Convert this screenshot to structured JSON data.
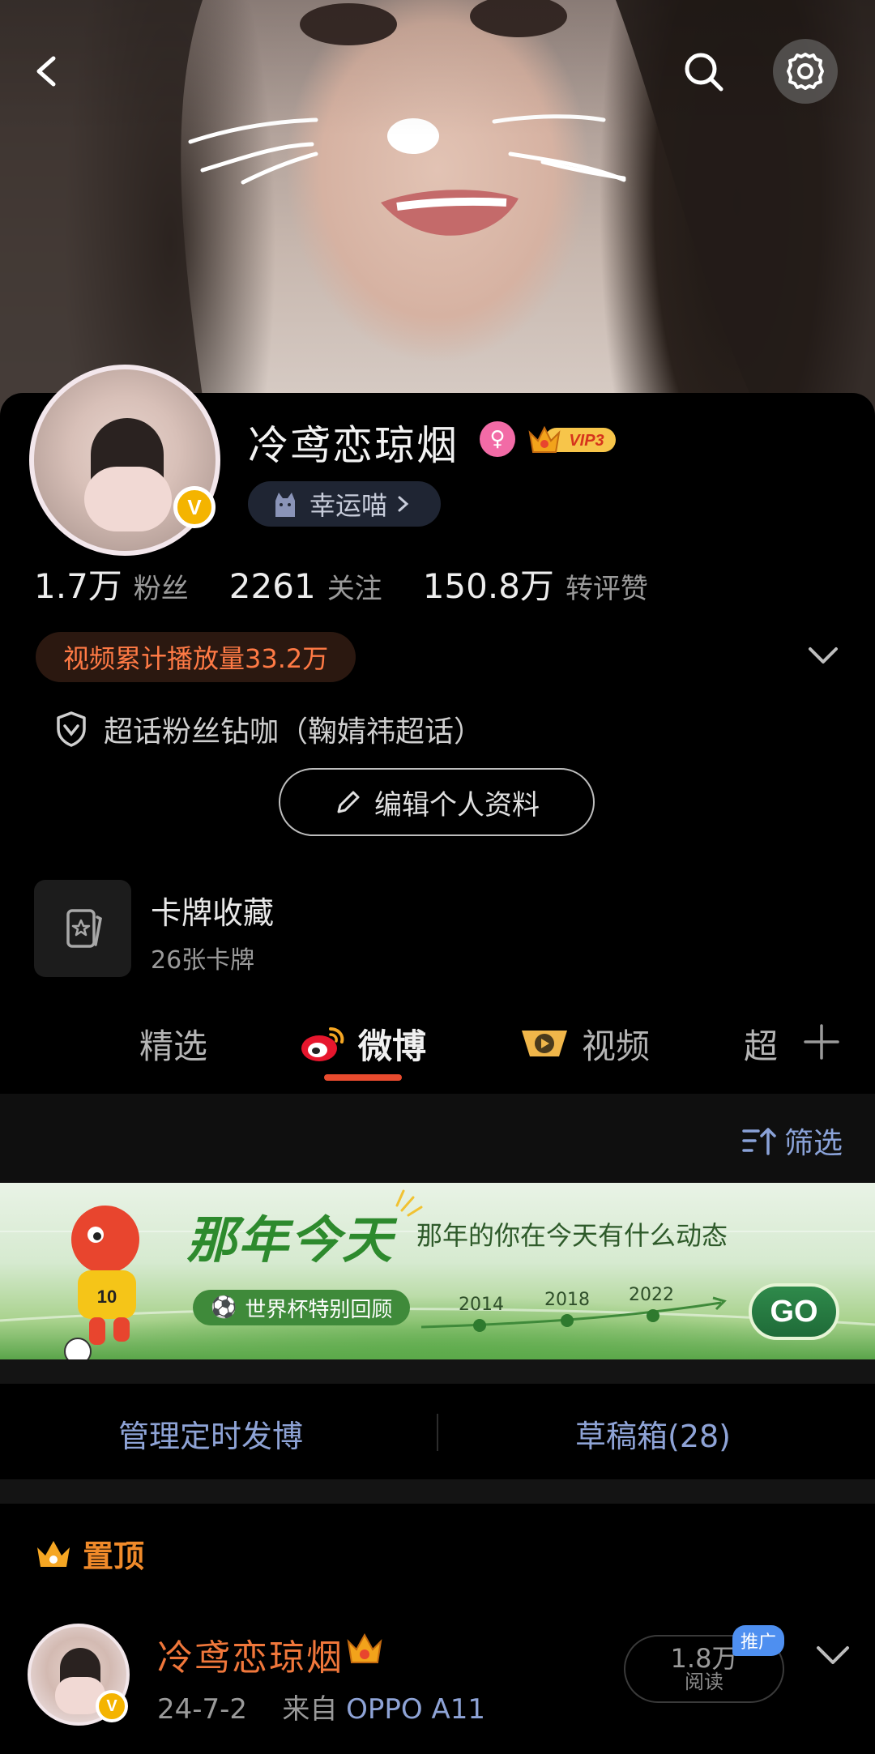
{
  "profile": {
    "name": "冷鸢恋琼烟",
    "vip_label": "VIP3",
    "verified_label": "V",
    "lucky_label": "幸运喵",
    "stats": [
      {
        "value": "1.7万",
        "label": "粉丝"
      },
      {
        "value": "2261",
        "label": "关注"
      },
      {
        "value": "150.8万",
        "label": "转评赞"
      }
    ],
    "play_count": "视频累计播放量33.2万",
    "super_topic": "超话粉丝钻咖（鞠婧祎超话）",
    "edit_button": "编辑个人资料",
    "cards": {
      "title": "卡牌收藏",
      "subtitle": "26张卡牌"
    }
  },
  "tabs": [
    {
      "label": "精选",
      "icon": ""
    },
    {
      "label": "微博",
      "icon": "weibo-logo-icon",
      "active": true
    },
    {
      "label": "视频",
      "icon": "video-icon"
    },
    {
      "label": "超",
      "icon": ""
    }
  ],
  "filter_label": "筛选",
  "banner": {
    "title": "那年今天",
    "subtitle": "那年的你在今天有什么动态",
    "pill": "世界杯特别回顾",
    "years": [
      "2014",
      "2018",
      "2022"
    ],
    "go": "GO",
    "mascot_number": "10"
  },
  "actions": {
    "schedule": "管理定时发博",
    "drafts": "草稿箱(28)"
  },
  "pinned_label": "置顶",
  "post": {
    "author": "冷鸢恋琼烟",
    "date": "24-7-2",
    "from_label": "来自",
    "device": "OPPO A11",
    "reads_value": "1.8万",
    "reads_label": "阅读",
    "promo_badge": "推广"
  },
  "colors": {
    "accent_orange": "#ff7a45",
    "link_blue": "#8ea3d6",
    "tab_underline": "#e84b2e",
    "vip_gold": "#f4b400"
  }
}
